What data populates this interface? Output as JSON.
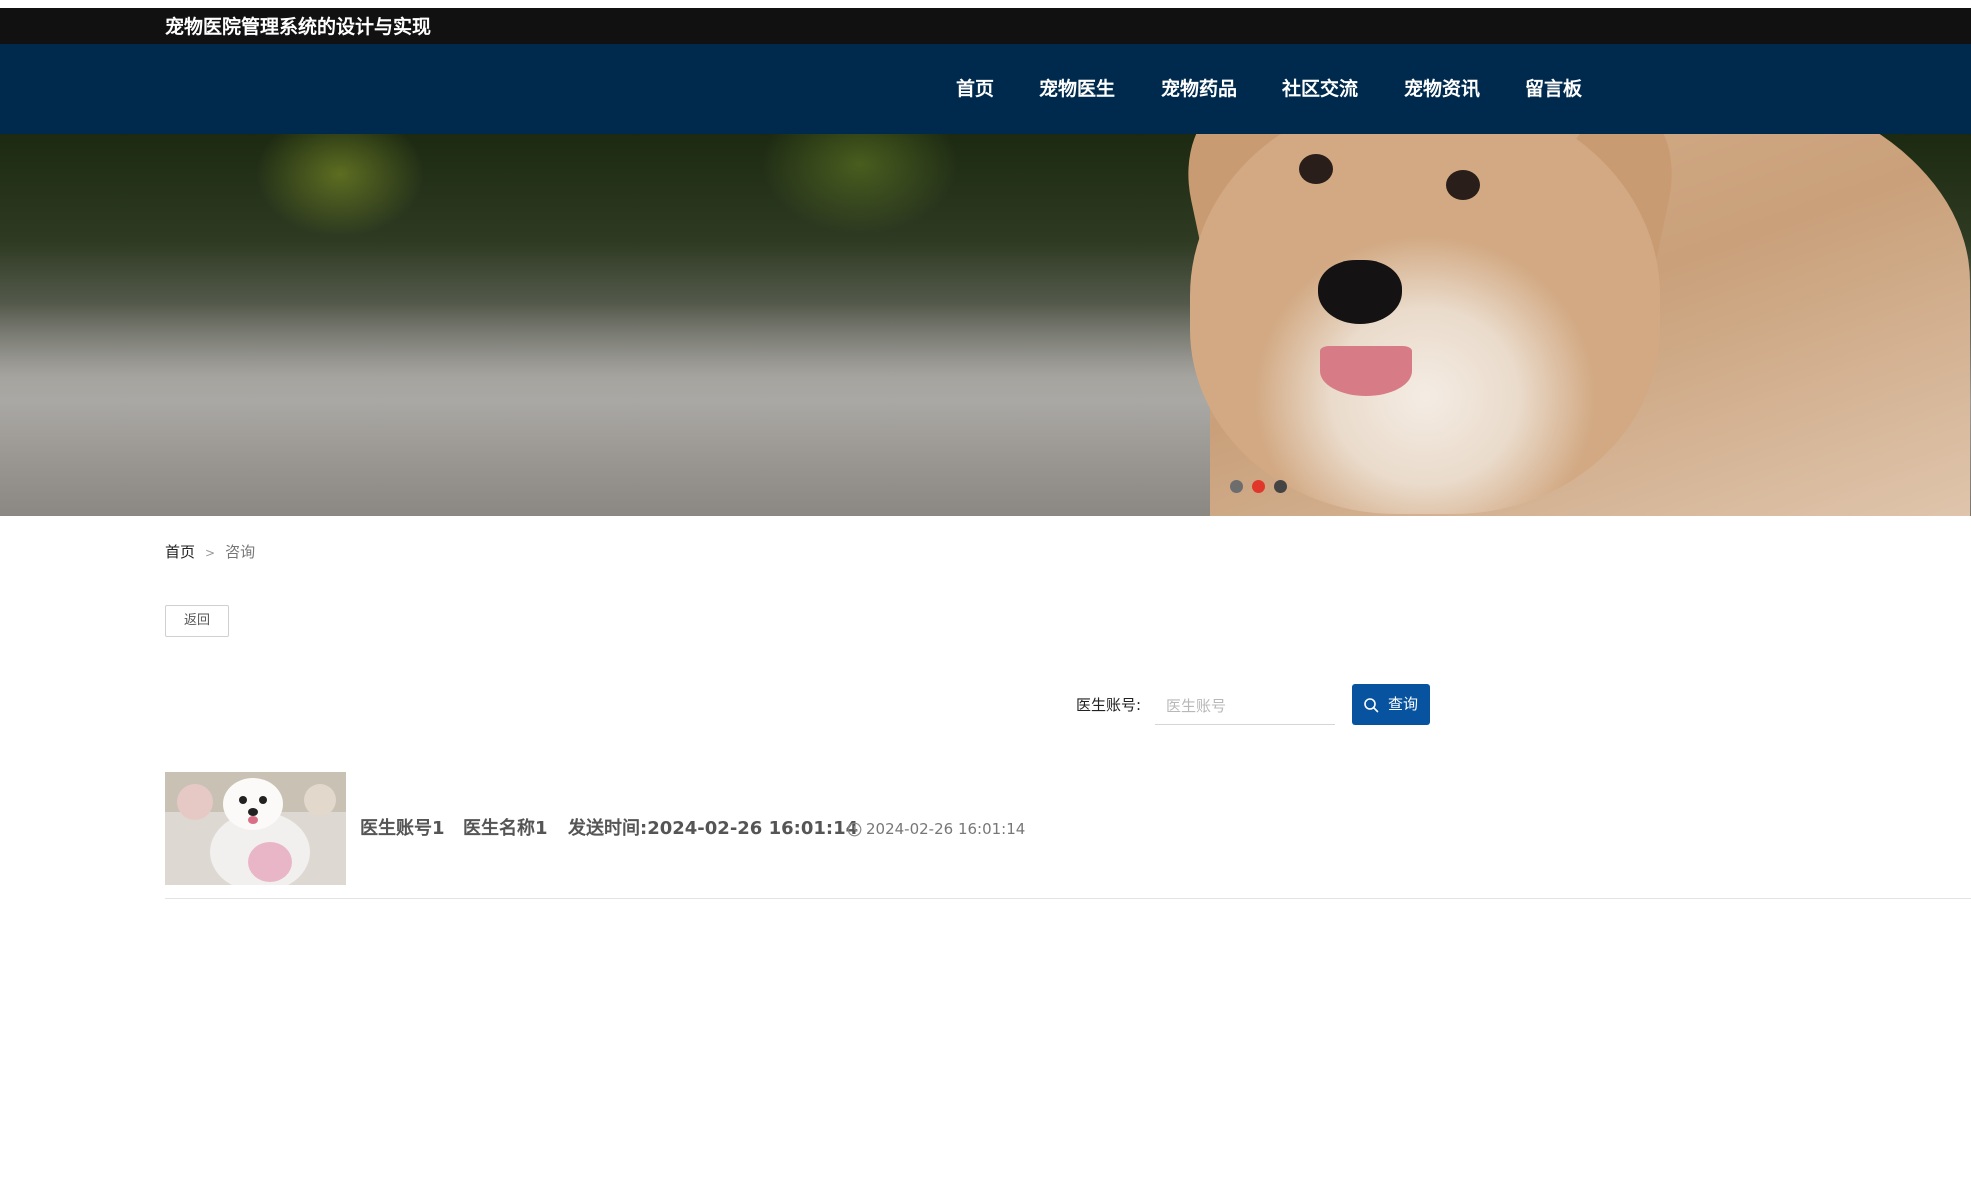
{
  "header": {
    "site_title": "宠物医院管理系统的设计与实现"
  },
  "nav": {
    "items": [
      {
        "label": "首页"
      },
      {
        "label": "宠物医生"
      },
      {
        "label": "宠物药品"
      },
      {
        "label": "社区交流"
      },
      {
        "label": "宠物资讯"
      },
      {
        "label": "留言板"
      }
    ]
  },
  "banner": {
    "slides_total": 3,
    "active_slide": 2,
    "colors": {
      "active_dot": "#e0372a",
      "inactive_dot": "#6d6d6d"
    }
  },
  "breadcrumb": {
    "home": "首页",
    "separator": ">",
    "current": "咨询"
  },
  "actions": {
    "back_label": "返回"
  },
  "search": {
    "label": "医生账号:",
    "value": "",
    "placeholder": "医生账号",
    "button_label": "查询",
    "button_icon": "search-icon"
  },
  "list": {
    "items": [
      {
        "doctor_account": "医生账号1",
        "doctor_name": "医生名称1",
        "send_time_text": "发送时间:2024-02-26 16:01:14",
        "timestamp": "2024-02-26 16:01:14",
        "time_icon": "clock-icon"
      }
    ]
  },
  "colors": {
    "title_bar": "#111111",
    "nav_bar": "#002a4d",
    "primary_button": "#07539f"
  }
}
